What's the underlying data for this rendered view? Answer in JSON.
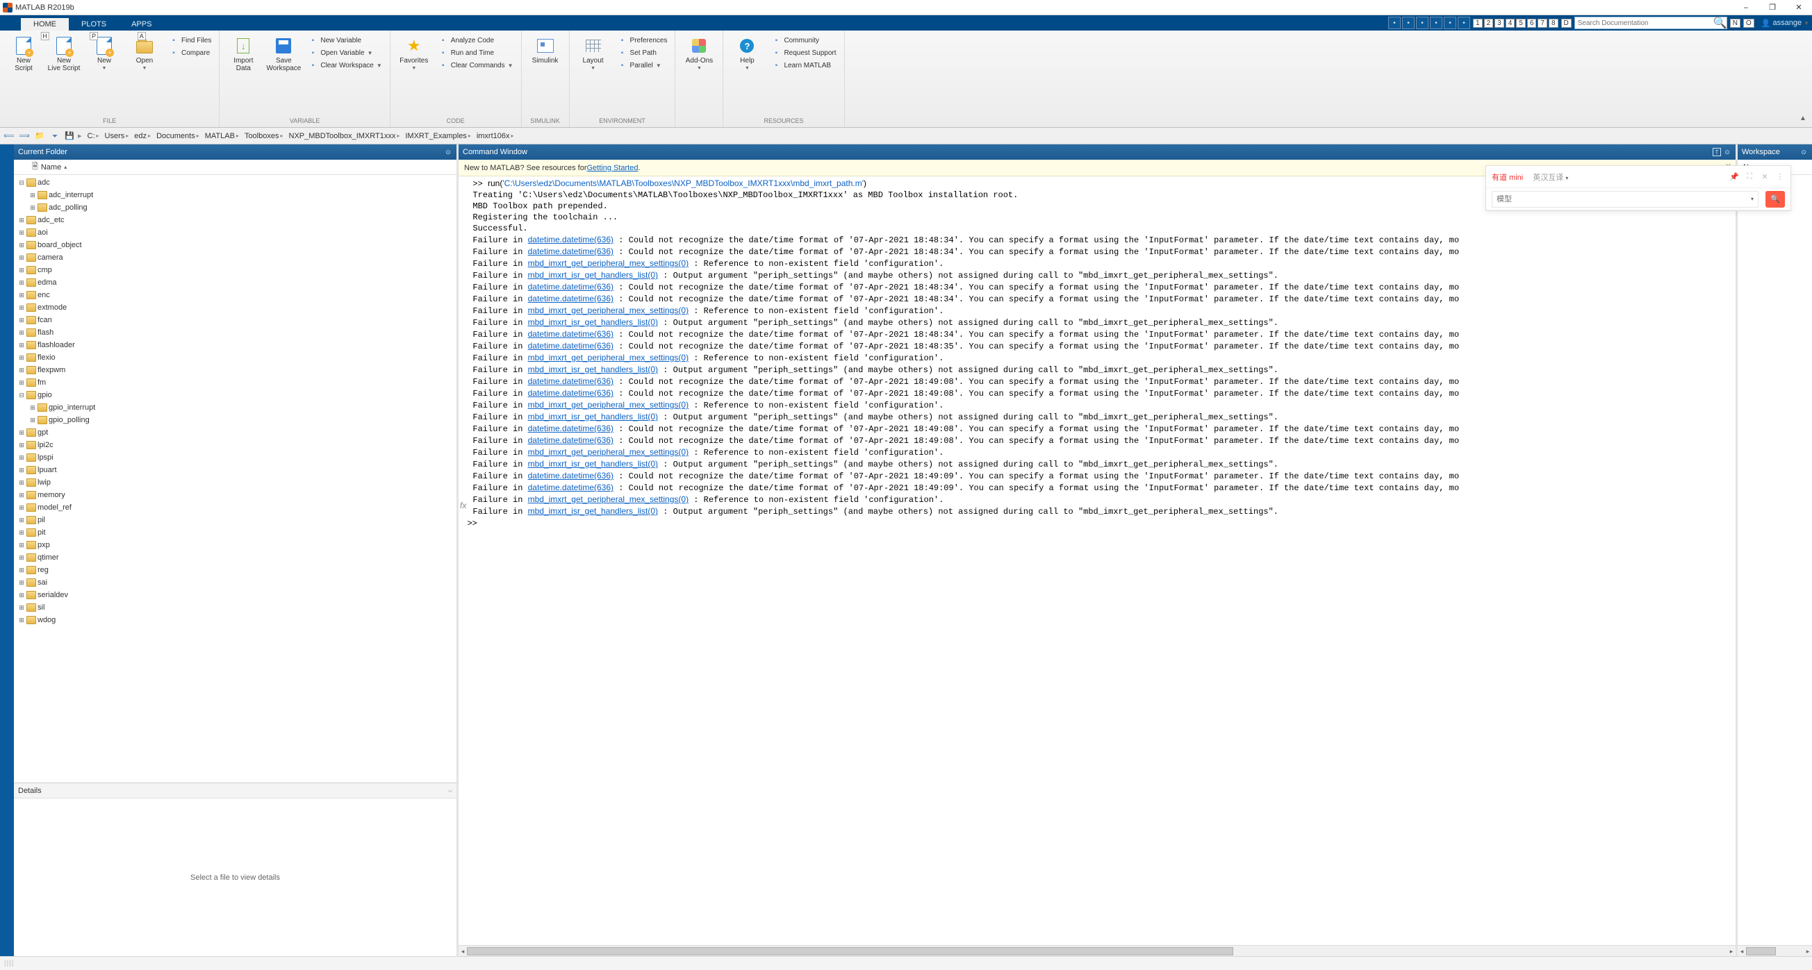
{
  "app": {
    "title": "MATLAB R2019b"
  },
  "window_buttons": {
    "min": "–",
    "max": "❐",
    "close": "✕"
  },
  "tabs": {
    "items": [
      {
        "label": "HOME",
        "key": "H",
        "active": true
      },
      {
        "label": "PLOTS",
        "key": "P"
      },
      {
        "label": "APPS",
        "key": "A"
      }
    ]
  },
  "quickaccess": {
    "numkeys": [
      "1",
      "2",
      "3",
      "4",
      "5",
      "6",
      "7",
      "8"
    ],
    "doc_search_placeholder": "Search Documentation",
    "end_keys": [
      "D",
      "N",
      "O"
    ],
    "user": "assange"
  },
  "ribbon": {
    "groups": [
      {
        "name": "FILE",
        "big": [
          {
            "id": "new-script",
            "label": "New\nScript",
            "icon": "doc-plus"
          },
          {
            "id": "new-live-script",
            "label": "New\nLive Script",
            "icon": "doc-plus"
          },
          {
            "id": "new",
            "label": "New",
            "icon": "doc-plus",
            "dropdown": true
          },
          {
            "id": "open",
            "label": "Open",
            "icon": "folder",
            "dropdown": true
          }
        ],
        "small": [
          {
            "id": "find-files",
            "label": "Find Files",
            "icon": "find"
          },
          {
            "id": "compare",
            "label": "Compare",
            "icon": "compare"
          }
        ]
      },
      {
        "name": "VARIABLE",
        "big": [
          {
            "id": "import-data",
            "label": "Import\nData",
            "icon": "import"
          },
          {
            "id": "save-workspace",
            "label": "Save\nWorkspace",
            "icon": "save"
          }
        ],
        "small": [
          {
            "id": "new-variable",
            "label": "New Variable",
            "icon": "var-new"
          },
          {
            "id": "open-variable",
            "label": "Open Variable",
            "icon": "var-open",
            "dropdown": true
          },
          {
            "id": "clear-workspace",
            "label": "Clear Workspace",
            "icon": "var-clear",
            "dropdown": true
          }
        ]
      },
      {
        "name": "CODE",
        "big": [
          {
            "id": "favorites",
            "label": "Favorites",
            "icon": "star",
            "dropdown": true
          }
        ],
        "small": [
          {
            "id": "analyze-code",
            "label": "Analyze Code",
            "icon": "analyze"
          },
          {
            "id": "run-and-time",
            "label": "Run and Time",
            "icon": "runtime"
          },
          {
            "id": "clear-commands",
            "label": "Clear Commands",
            "icon": "clear",
            "dropdown": true
          }
        ]
      },
      {
        "name": "SIMULINK",
        "big": [
          {
            "id": "simulink",
            "label": "Simulink",
            "icon": "sim"
          }
        ]
      },
      {
        "name": "ENVIRONMENT",
        "big": [
          {
            "id": "layout",
            "label": "Layout",
            "icon": "grid",
            "dropdown": true
          }
        ],
        "small": [
          {
            "id": "preferences",
            "label": "Preferences",
            "icon": "gear"
          },
          {
            "id": "set-path",
            "label": "Set Path",
            "icon": "path"
          },
          {
            "id": "parallel",
            "label": "Parallel",
            "icon": "parallel",
            "dropdown": true
          }
        ]
      },
      {
        "name": "",
        "big": [
          {
            "id": "addons",
            "label": "Add-Ons",
            "icon": "addon",
            "dropdown": true
          }
        ]
      },
      {
        "name": "RESOURCES",
        "big": [
          {
            "id": "help",
            "label": "Help",
            "icon": "help",
            "dropdown": true
          }
        ],
        "small": [
          {
            "id": "community",
            "label": "Community",
            "icon": "community"
          },
          {
            "id": "request-support",
            "label": "Request Support",
            "icon": "support"
          },
          {
            "id": "learn-matlab",
            "label": "Learn MATLAB",
            "icon": "learn"
          }
        ]
      }
    ]
  },
  "address": {
    "crumbs": [
      "C:",
      "Users",
      "edz",
      "Documents",
      "MATLAB",
      "Toolboxes",
      "NXP_MBDToolbox_IMXRT1xxx",
      "IMXRT_Examples",
      "imxrt106x"
    ]
  },
  "panels": {
    "current_folder": {
      "title": "Current Folder",
      "column": "Name"
    },
    "command_window": {
      "title": "Command Window"
    },
    "workspace": {
      "title": "Workspace",
      "column": "Name"
    },
    "details": {
      "title": "Details",
      "placeholder": "Select a file to view details"
    }
  },
  "folder_tree": [
    {
      "name": "adc",
      "depth": 0,
      "expanded": true
    },
    {
      "name": "adc_interrupt",
      "depth": 1
    },
    {
      "name": "adc_polling",
      "depth": 1
    },
    {
      "name": "adc_etc",
      "depth": 0
    },
    {
      "name": "aoi",
      "depth": 0
    },
    {
      "name": "board_object",
      "depth": 0
    },
    {
      "name": "camera",
      "depth": 0
    },
    {
      "name": "cmp",
      "depth": 0
    },
    {
      "name": "edma",
      "depth": 0
    },
    {
      "name": "enc",
      "depth": 0
    },
    {
      "name": "extmode",
      "depth": 0
    },
    {
      "name": "fcan",
      "depth": 0
    },
    {
      "name": "flash",
      "depth": 0
    },
    {
      "name": "flashloader",
      "depth": 0
    },
    {
      "name": "flexio",
      "depth": 0
    },
    {
      "name": "flexpwm",
      "depth": 0
    },
    {
      "name": "fm",
      "depth": 0
    },
    {
      "name": "gpio",
      "depth": 0,
      "expanded": true
    },
    {
      "name": "gpio_interrupt",
      "depth": 1
    },
    {
      "name": "gpio_polling",
      "depth": 1
    },
    {
      "name": "gpt",
      "depth": 0
    },
    {
      "name": "lpi2c",
      "depth": 0
    },
    {
      "name": "lpspi",
      "depth": 0
    },
    {
      "name": "lpuart",
      "depth": 0
    },
    {
      "name": "lwip",
      "depth": 0
    },
    {
      "name": "memory",
      "depth": 0
    },
    {
      "name": "model_ref",
      "depth": 0
    },
    {
      "name": "pil",
      "depth": 0
    },
    {
      "name": "pit",
      "depth": 0
    },
    {
      "name": "pxp",
      "depth": 0
    },
    {
      "name": "qtimer",
      "depth": 0
    },
    {
      "name": "reg",
      "depth": 0
    },
    {
      "name": "sai",
      "depth": 0
    },
    {
      "name": "serialdev",
      "depth": 0
    },
    {
      "name": "sil",
      "depth": 0
    },
    {
      "name": "wdog",
      "depth": 0
    }
  ],
  "banner": {
    "prefix": "New to MATLAB? See resources for ",
    "link": "Getting Started",
    "suffix": "."
  },
  "console": {
    "prompt": ">> ",
    "run_cmd": "run(",
    "run_path": "'C:\\Users\\edz\\Documents\\MATLAB\\Toolboxes\\NXP_MBDToolbox_IMXRT1xxx\\mbd_imxrt_path.m'",
    "run_close": ")",
    "pre_lines": [
      "Treating 'C:\\Users\\edz\\Documents\\MATLAB\\Toolboxes\\NXP_MBDToolbox_IMXRT1xxx' as MBD Toolbox installation root.",
      "MBD Toolbox path prepended.",
      "Registering the toolchain ...",
      "Successful."
    ],
    "fail_prefix": "Failure in ",
    "links": {
      "dt": "datetime.datetime(636)",
      "ps": "mbd_imxrt_get_peripheral_mex_settings(0)",
      "isr": "mbd_imxrt_isr_get_handlers_list(0)"
    },
    "msgs": {
      "dt_a": " : Could not recognize the date/time format of '07-Apr-2021 18:48:34'. You can specify a format using the 'InputFormat' parameter. If the date/time text contains day, mo",
      "dt_b": " : Could not recognize the date/time format of '07-Apr-2021 18:48:35'. You can specify a format using the 'InputFormat' parameter. If the date/time text contains day, mo",
      "dt_c": " : Could not recognize the date/time format of '07-Apr-2021 18:49:08'. You can specify a format using the 'InputFormat' parameter. If the date/time text contains day, mo",
      "dt_d": " : Could not recognize the date/time format of '07-Apr-2021 18:49:09'. You can specify a format using the 'InputFormat' parameter. If the date/time text contains day, mo",
      "ps": " : Reference to non-existent field 'configuration'.",
      "isr": " : Output argument \"periph_settings\" (and maybe others) not assigned during call to \"mbd_imxrt_get_peripheral_mex_settings\"."
    },
    "sequence": [
      [
        "dt",
        "dt_a"
      ],
      [
        "dt",
        "dt_a"
      ],
      [
        "ps",
        "ps"
      ],
      [
        "isr",
        "isr"
      ],
      [
        "dt",
        "dt_a"
      ],
      [
        "dt",
        "dt_a"
      ],
      [
        "ps",
        "ps"
      ],
      [
        "isr",
        "isr"
      ],
      [
        "dt",
        "dt_a"
      ],
      [
        "dt",
        "dt_b"
      ],
      [
        "ps",
        "ps"
      ],
      [
        "isr",
        "isr"
      ],
      [
        "dt",
        "dt_c"
      ],
      [
        "dt",
        "dt_c"
      ],
      [
        "ps",
        "ps"
      ],
      [
        "isr",
        "isr"
      ],
      [
        "dt",
        "dt_c"
      ],
      [
        "dt",
        "dt_c"
      ],
      [
        "ps",
        "ps"
      ],
      [
        "isr",
        "isr"
      ],
      [
        "dt",
        "dt_d"
      ],
      [
        "dt",
        "dt_d"
      ],
      [
        "ps",
        "ps"
      ],
      [
        "isr",
        "isr"
      ]
    ],
    "fx": "fx",
    "final_prompt": ">> "
  },
  "overlay": {
    "tab_active": "有道 mini",
    "tab_other": "英汉互译",
    "search_placeholder": "模型"
  },
  "status": {
    "grip": "||||"
  }
}
